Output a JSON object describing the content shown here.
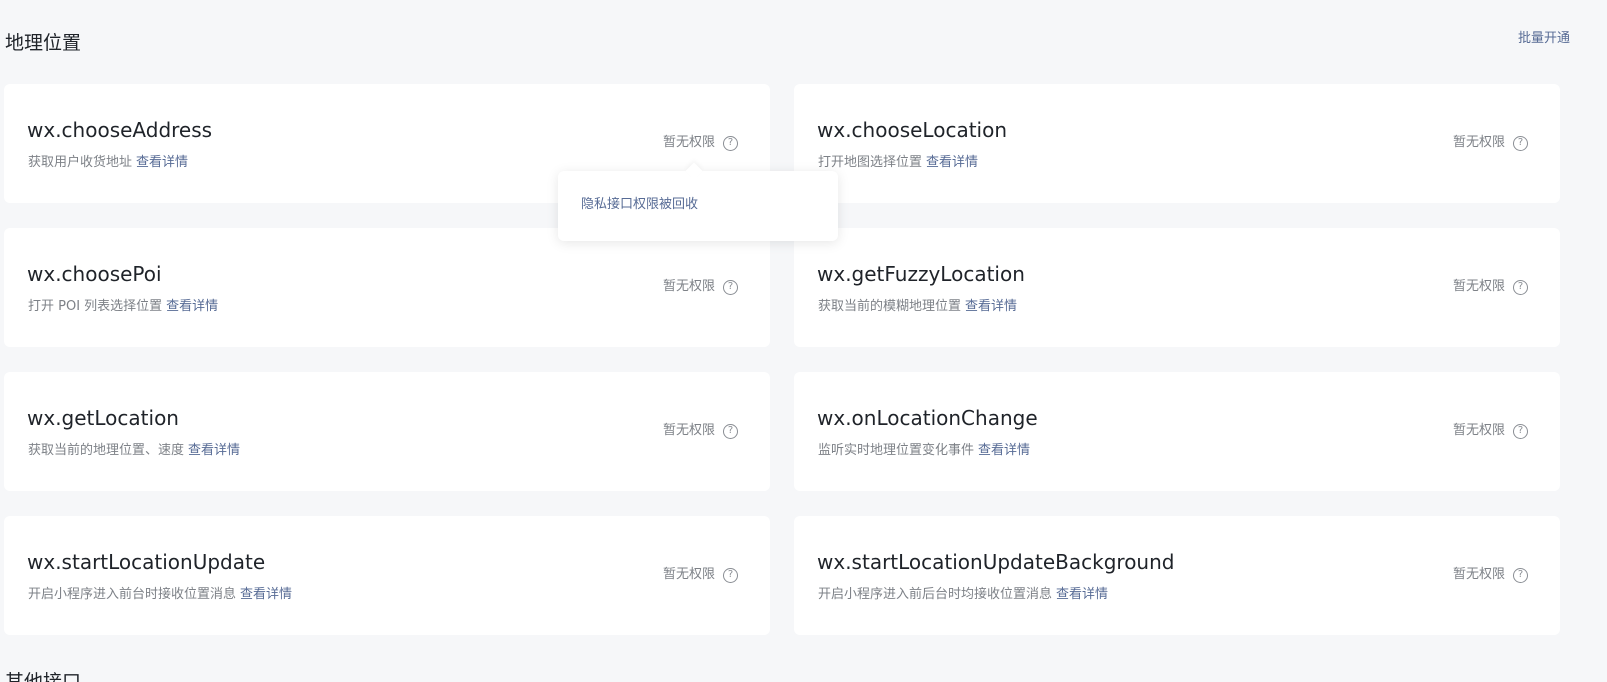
{
  "section": {
    "title": "地理位置",
    "batch_action": "批量开通"
  },
  "cards": [
    {
      "title": "wx.chooseAddress",
      "desc": "获取用户收货地址",
      "link": "查看详情",
      "permission": "暂无权限"
    },
    {
      "title": "wx.chooseLocation",
      "desc": "打开地图选择位置",
      "link": "查看详情",
      "permission": "暂无权限"
    },
    {
      "title": "wx.choosePoi",
      "desc": "打开 POI 列表选择位置",
      "link": "查看详情",
      "permission": "暂无权限"
    },
    {
      "title": "wx.getFuzzyLocation",
      "desc": "获取当前的模糊地理位置",
      "link": "查看详情",
      "permission": "暂无权限"
    },
    {
      "title": "wx.getLocation",
      "desc": "获取当前的地理位置、速度",
      "link": "查看详情",
      "permission": "暂无权限"
    },
    {
      "title": "wx.onLocationChange",
      "desc": "监听实时地理位置变化事件",
      "link": "查看详情",
      "permission": "暂无权限"
    },
    {
      "title": "wx.startLocationUpdate",
      "desc": "开启小程序进入前台时接收位置消息",
      "link": "查看详情",
      "permission": "暂无权限"
    },
    {
      "title": "wx.startLocationUpdateBackground",
      "desc": "开启小程序进入前后台时均接收位置消息",
      "link": "查看详情",
      "permission": "暂无权限"
    }
  ],
  "popover": {
    "text": "隐私接口权限被回收"
  },
  "next_section": {
    "title": "其他接口"
  },
  "icons": {
    "help": "question-circle-icon"
  },
  "colors": {
    "link": "#576b95",
    "muted_text": "#7d8187",
    "background": "#f6f7f9",
    "card": "#ffffff"
  }
}
